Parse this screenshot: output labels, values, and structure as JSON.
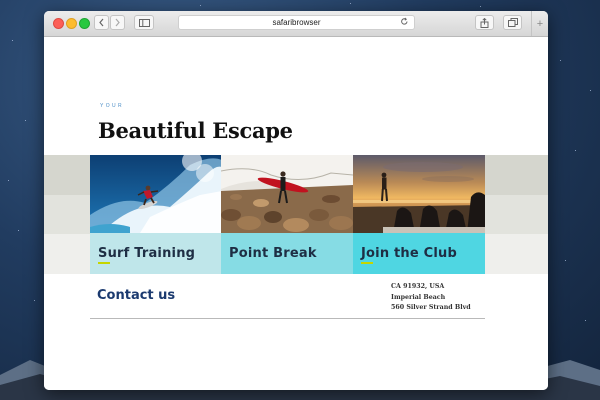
{
  "browser": {
    "address": "safaribrowser"
  },
  "page": {
    "eyebrow": "YOUR",
    "headline": "Beautiful Escape",
    "cards": [
      {
        "label": "Surf Training"
      },
      {
        "label": "Point Break"
      },
      {
        "label": "Join the Club"
      }
    ],
    "contact": "Contact us",
    "address_lines": [
      "CA 91932, USA",
      "Imperial Beach",
      "560 Silver Strand Blvd"
    ]
  },
  "colors": {
    "card1": "#bfe6ea",
    "card2": "#86dce4",
    "card3": "#4fd6e2",
    "eyebrow": "#4e8fc7",
    "contact": "#1b3a6f"
  },
  "icons": [
    "back-icon",
    "forward-icon",
    "sidebar-icon",
    "reload-icon",
    "share-icon",
    "tabs-icon",
    "new-tab-icon"
  ]
}
